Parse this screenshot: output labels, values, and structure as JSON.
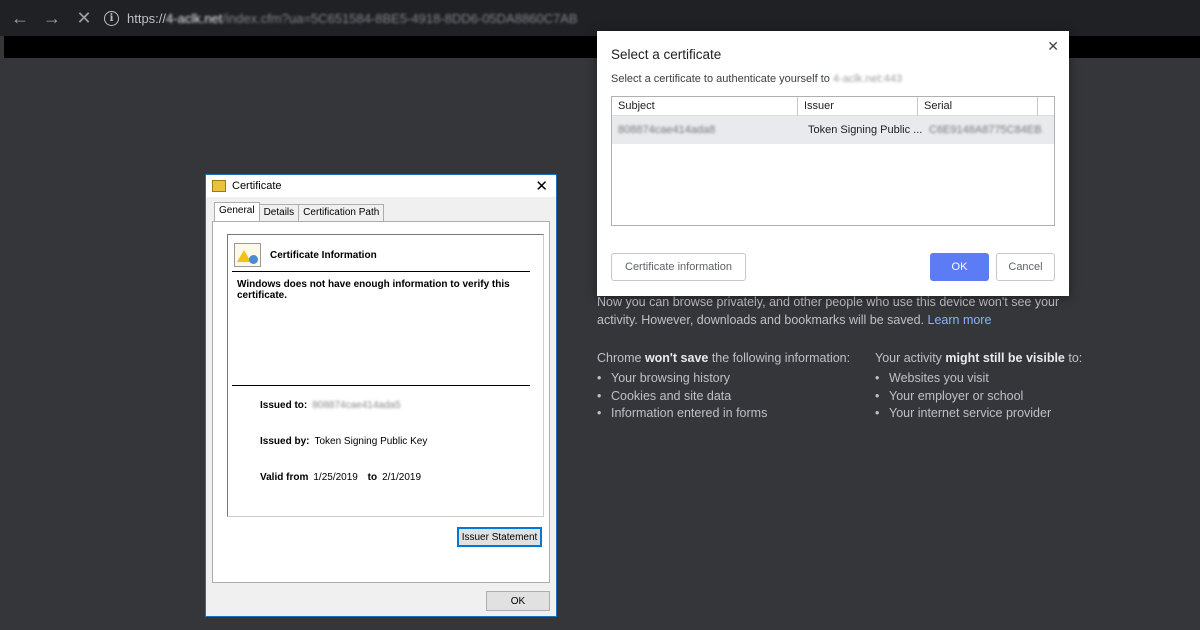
{
  "browser": {
    "back_icon": "back-arrow-icon",
    "forward_icon": "forward-arrow-icon",
    "stop_icon": "stop-loading-icon",
    "url_scheme": "https://",
    "url_host": "4-aclk.net",
    "url_path": "/index.cfm?ua=5C651584-8BE5-4918-8DD6-05DA8860C7AB"
  },
  "incognito": {
    "intro": "Now you can browse privately, and other people who use this device won't see your activity. However, downloads and bookmarks will be saved.",
    "learn_more": "Learn more",
    "wont_save_prefix": "Chrome ",
    "wont_save_bold": "won't save",
    "wont_save_suffix": " the following information:",
    "wont_save_items": [
      "Your browsing history",
      "Cookies and site data",
      "Information entered in forms"
    ],
    "visible_prefix": "Your activity ",
    "visible_bold": "might still be visible",
    "visible_suffix": " to:",
    "visible_items": [
      "Websites you visit",
      "Your employer or school",
      "Your internet service provider"
    ]
  },
  "select_cert": {
    "title": "Select a certificate",
    "subtitle_prefix": "Select a certificate to authenticate yourself to ",
    "subtitle_host": "4-aclk.net:443",
    "columns": [
      "Subject",
      "Issuer",
      "Serial"
    ],
    "row": {
      "subject": "808874cae414ada8",
      "issuer": "Token Signing Public ...",
      "serial": "C6E9148A8775C84EB..."
    },
    "cert_info_button": "Certificate information",
    "ok_button": "OK",
    "cancel_button": "Cancel"
  },
  "win_cert": {
    "title": "Certificate",
    "tabs": [
      "General",
      "Details",
      "Certification Path"
    ],
    "heading": "Certificate Information",
    "warning": "Windows does not have enough information to verify this certificate.",
    "issued_to_label": "Issued to:",
    "issued_to_value": "808874cae414ada5",
    "issued_by_label": "Issued by:",
    "issued_by_value": "Token Signing Public Key",
    "valid_from_label": "Valid from",
    "valid_from_value": "1/25/2019",
    "valid_to_label": "to",
    "valid_to_value": "2/1/2019",
    "issuer_statement_button": "Issuer Statement",
    "ok_button": "OK"
  }
}
